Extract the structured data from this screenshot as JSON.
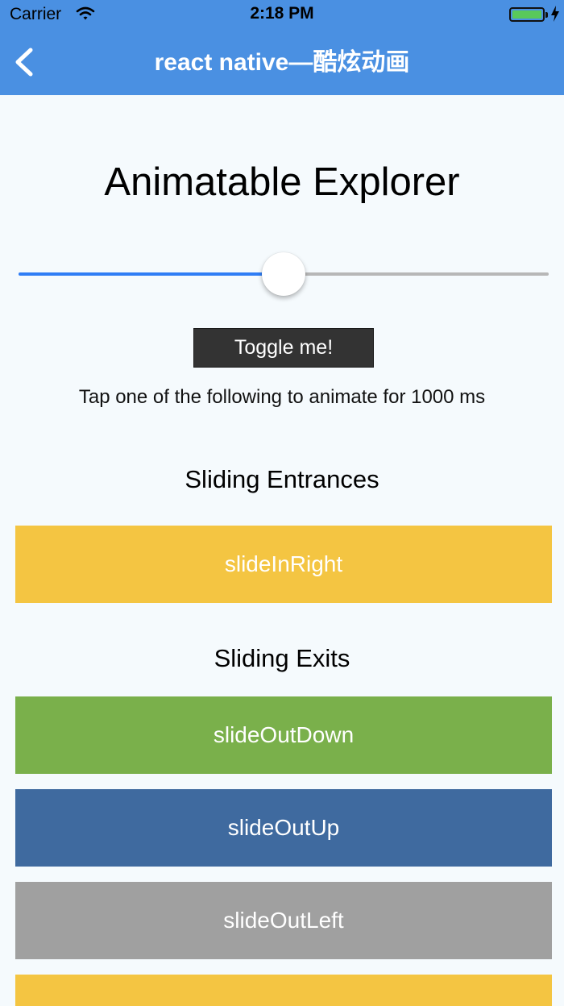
{
  "status_bar": {
    "carrier": "Carrier",
    "time": "2:18 PM",
    "battery_level": 1.0,
    "battery_color": "#59c95b"
  },
  "nav": {
    "title": "react native—酷炫动画",
    "back_icon": "chevron-left-icon",
    "bg_color": "#4a90e2"
  },
  "page": {
    "title": "Animatable Explorer",
    "background": "#f5fafd"
  },
  "slider": {
    "value": 0.5,
    "min_track_color": "#2f7df5",
    "max_track_color": "#b7b7b7"
  },
  "toggle": {
    "label": "Toggle me!"
  },
  "hint": "Tap one of the following to animate for 1000 ms",
  "sections": [
    {
      "title": "Sliding Entrances",
      "items": [
        {
          "label": "slideInRight",
          "color": "#f4c542"
        }
      ]
    },
    {
      "title": "Sliding Exits",
      "items": [
        {
          "label": "slideOutDown",
          "color": "#7ab04b"
        },
        {
          "label": "slideOutUp",
          "color": "#3f6a9f"
        },
        {
          "label": "slideOutLeft",
          "color": "#a0a0a0"
        },
        {
          "label": "",
          "color": "#f4c542"
        }
      ]
    }
  ]
}
